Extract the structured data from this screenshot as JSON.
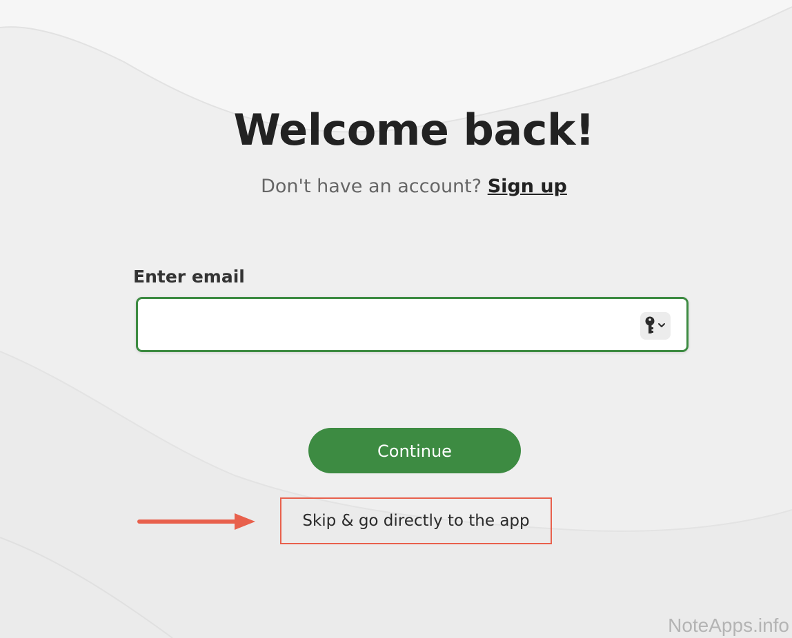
{
  "header": {
    "title": "Welcome back!",
    "subtitle_prefix": "Don't have an account?",
    "signup_link": "Sign up"
  },
  "form": {
    "email_label": "Enter email",
    "email_value": "",
    "email_placeholder": "",
    "password_manager_icon": "key-icon"
  },
  "actions": {
    "continue_label": "Continue",
    "skip_label": "Skip & go directly to the app"
  },
  "annotation": {
    "arrow_color": "#e8604c",
    "box_color": "#e8604c"
  },
  "theme": {
    "accent": "#3d8b42",
    "background": "#efefef"
  },
  "watermark": "NoteApps.info"
}
